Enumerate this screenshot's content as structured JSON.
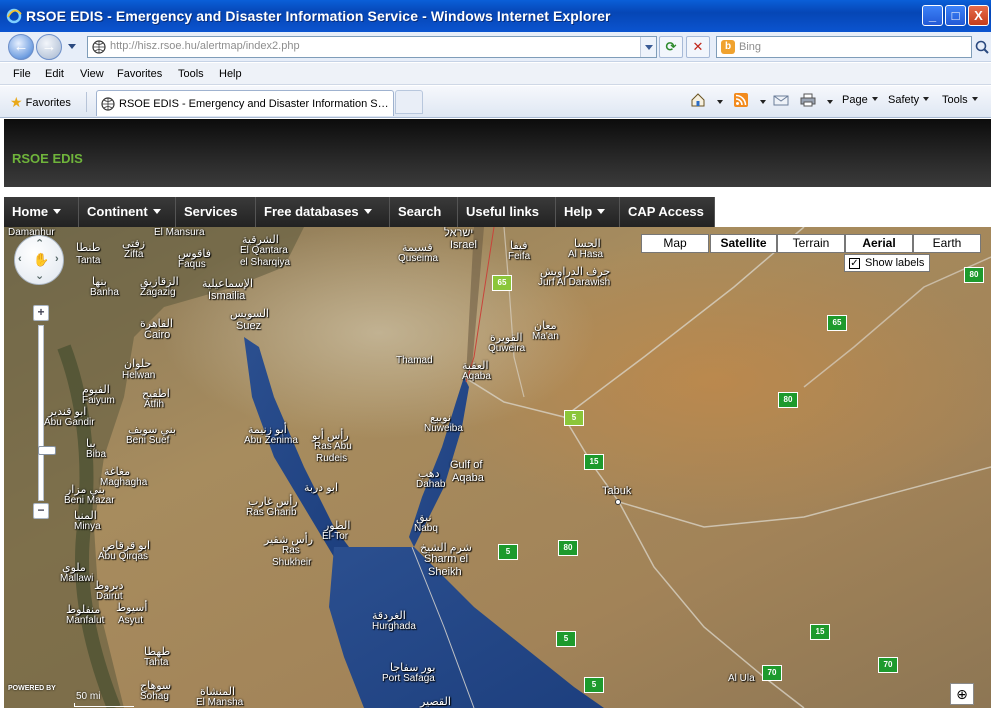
{
  "window": {
    "title": "RSOE EDIS - Emergency and Disaster Information Service - Windows Internet Explorer",
    "minimize": "_",
    "maximize": "□",
    "close": "X"
  },
  "address": {
    "url_host": "http://hisz.rsoe.hu",
    "url_path": "/alertmap/index2.php",
    "refresh": "⟳",
    "stop": "✕",
    "search_placeholder": "Bing",
    "bing_letter": "b"
  },
  "menu": [
    "File",
    "Edit",
    "View",
    "Favorites",
    "Tools",
    "Help"
  ],
  "favorites_label": "Favorites",
  "tab": {
    "title": "RSOE EDIS - Emergency and Disaster Information Ser..."
  },
  "commands": {
    "page": "Page",
    "safety": "Safety",
    "tools": "Tools"
  },
  "site": {
    "brand": "RSOE EDIS",
    "nav": [
      {
        "label": "Home",
        "dropdown": true
      },
      {
        "label": "Continent",
        "dropdown": true
      },
      {
        "label": "Services",
        "dropdown": false
      },
      {
        "label": "Free databases",
        "dropdown": true
      },
      {
        "label": "Search",
        "dropdown": false
      },
      {
        "label": "Useful links",
        "dropdown": false
      },
      {
        "label": "Help",
        "dropdown": true
      },
      {
        "label": "CAP Access",
        "dropdown": false
      }
    ]
  },
  "map": {
    "types": [
      "Map",
      "Satellite",
      "Terrain",
      "Aerial",
      "Earth"
    ],
    "selected_types": [
      "Satellite",
      "Aerial"
    ],
    "show_labels": "Show labels",
    "show_labels_checked": true,
    "checkmark": "✓",
    "scale": "50 mi",
    "powered_by": "POWERED BY",
    "zoom_in": "+",
    "zoom_out": "−",
    "zoom_level_fraction": 0.72,
    "zoom_icon": "⊕",
    "labels": [
      {
        "text": "Damanhur",
        "cls": ""
      },
      {
        "text": "El Mansura",
        "cls": ""
      },
      {
        "text": "طنطا",
        "cls": "ar"
      },
      {
        "text": "Tanta",
        "cls": ""
      },
      {
        "text": "زفتى",
        "cls": "ar"
      },
      {
        "text": "Zifta",
        "cls": ""
      },
      {
        "text": "فاقوس",
        "cls": "ar"
      },
      {
        "text": "Faqus",
        "cls": ""
      },
      {
        "text": "الشرقية",
        "cls": "ar"
      },
      {
        "text": "El Qantara",
        "cls": ""
      },
      {
        "text": "el Sharqiya",
        "cls": ""
      },
      {
        "text": "بنها",
        "cls": "ar"
      },
      {
        "text": "Banha",
        "cls": ""
      },
      {
        "text": "الزقازيق",
        "cls": "ar"
      },
      {
        "text": "Zagazig",
        "cls": ""
      },
      {
        "text": "الإسماعيلية",
        "cls": "ar"
      },
      {
        "text": "Ismailia",
        "cls": ""
      },
      {
        "text": "السويس",
        "cls": "ar"
      },
      {
        "text": "Suez",
        "cls": "big"
      },
      {
        "text": "القاهرة",
        "cls": "ar"
      },
      {
        "text": "Cairo",
        "cls": "big"
      },
      {
        "text": "حلوان",
        "cls": "ar"
      },
      {
        "text": "Helwan",
        "cls": ""
      },
      {
        "text": "الفيوم",
        "cls": "ar"
      },
      {
        "text": "Faiyum",
        "cls": ""
      },
      {
        "text": "اطفيح",
        "cls": "ar"
      },
      {
        "text": "Atfih",
        "cls": ""
      },
      {
        "text": "ابو قندير",
        "cls": "ar"
      },
      {
        "text": "Abu Gandir",
        "cls": ""
      },
      {
        "text": "بني سويف",
        "cls": "ar"
      },
      {
        "text": "Beni Suef",
        "cls": ""
      },
      {
        "text": "ببا",
        "cls": "ar"
      },
      {
        "text": "Biba",
        "cls": ""
      },
      {
        "text": "مغاغة",
        "cls": "ar"
      },
      {
        "text": "Maghagha",
        "cls": ""
      },
      {
        "text": "بني مزار",
        "cls": "ar"
      },
      {
        "text": "Beni Mazar",
        "cls": ""
      },
      {
        "text": "المنيا",
        "cls": "ar"
      },
      {
        "text": "Minya",
        "cls": ""
      },
      {
        "text": "ابو قرقاص",
        "cls": "ar"
      },
      {
        "text": "Abu Qirqas",
        "cls": ""
      },
      {
        "text": "ملوي",
        "cls": "ar"
      },
      {
        "text": "Mallawi",
        "cls": ""
      },
      {
        "text": "ديروط",
        "cls": "ar"
      },
      {
        "text": "Dairut",
        "cls": ""
      },
      {
        "text": "منفلوط",
        "cls": "ar"
      },
      {
        "text": "Manfalut",
        "cls": ""
      },
      {
        "text": "أسيوط",
        "cls": "ar"
      },
      {
        "text": "Asyut",
        "cls": ""
      },
      {
        "text": "طهطا",
        "cls": "ar"
      },
      {
        "text": "Tahta",
        "cls": ""
      },
      {
        "text": "سوهاج",
        "cls": "ar"
      },
      {
        "text": "Sohag",
        "cls": ""
      },
      {
        "text": "المنشاة",
        "cls": "ar"
      },
      {
        "text": "El Mansha",
        "cls": ""
      },
      {
        "text": "ישראל",
        "cls": "big"
      },
      {
        "text": "Israel",
        "cls": "big"
      },
      {
        "text": "قسيمة",
        "cls": "ar"
      },
      {
        "text": "Quseima",
        "cls": ""
      },
      {
        "text": "فيفا",
        "cls": "ar"
      },
      {
        "text": "Feifa",
        "cls": ""
      },
      {
        "text": "الحسا",
        "cls": "ar"
      },
      {
        "text": "Al Hasa",
        "cls": ""
      },
      {
        "text": "جرف الدراويش",
        "cls": "ar"
      },
      {
        "text": "Jurf Al Darawish",
        "cls": ""
      },
      {
        "text": "معان",
        "cls": "ar"
      },
      {
        "text": "Ma'an",
        "cls": ""
      },
      {
        "text": "القويرة",
        "cls": "ar"
      },
      {
        "text": "Quweira",
        "cls": ""
      },
      {
        "text": "Thamad",
        "cls": ""
      },
      {
        "text": "العقبة",
        "cls": "ar"
      },
      {
        "text": "Aqaba",
        "cls": ""
      },
      {
        "text": "نويبع",
        "cls": "ar"
      },
      {
        "text": "Nuweiba",
        "cls": ""
      },
      {
        "text": "رأس أبو",
        "cls": "ar"
      },
      {
        "text": "Ras Abu",
        "cls": ""
      },
      {
        "text": "Rudeis",
        "cls": ""
      },
      {
        "text": "أبو زنيمة",
        "cls": "ar"
      },
      {
        "text": "Abu Zenima",
        "cls": ""
      },
      {
        "text": "ابو دربة",
        "cls": "ar"
      },
      {
        "text": "Gulf of",
        "cls": "big"
      },
      {
        "text": "Aqaba",
        "cls": "big"
      },
      {
        "text": "دهب",
        "cls": "ar"
      },
      {
        "text": "Dahab",
        "cls": ""
      },
      {
        "text": "رأس غارب",
        "cls": "ar"
      },
      {
        "text": "Ras Gharib",
        "cls": ""
      },
      {
        "text": "الطور",
        "cls": "ar"
      },
      {
        "text": "El-Tor",
        "cls": ""
      },
      {
        "text": "نبق",
        "cls": "ar"
      },
      {
        "text": "Nabq",
        "cls": ""
      },
      {
        "text": "رأس شقير",
        "cls": "ar"
      },
      {
        "text": "Ras",
        "cls": ""
      },
      {
        "text": "Shukheir",
        "cls": ""
      },
      {
        "text": "شرم الشيخ",
        "cls": "ar"
      },
      {
        "text": "Sharm el",
        "cls": "big"
      },
      {
        "text": "Sheikh",
        "cls": "big"
      },
      {
        "text": "Tabuk",
        "cls": "big"
      },
      {
        "text": "الغردقة",
        "cls": "ar"
      },
      {
        "text": "Hurghada",
        "cls": ""
      },
      {
        "text": "بور سفاجا",
        "cls": "ar"
      },
      {
        "text": "Port Safaga",
        "cls": ""
      },
      {
        "text": "القصير",
        "cls": "ar"
      },
      {
        "text": "Al Ula",
        "cls": ""
      }
    ],
    "shields": [
      "65",
      "5",
      "65",
      "80",
      "80",
      "15",
      "5",
      "80",
      "5",
      "15",
      "70",
      "70",
      "5",
      "80"
    ]
  }
}
